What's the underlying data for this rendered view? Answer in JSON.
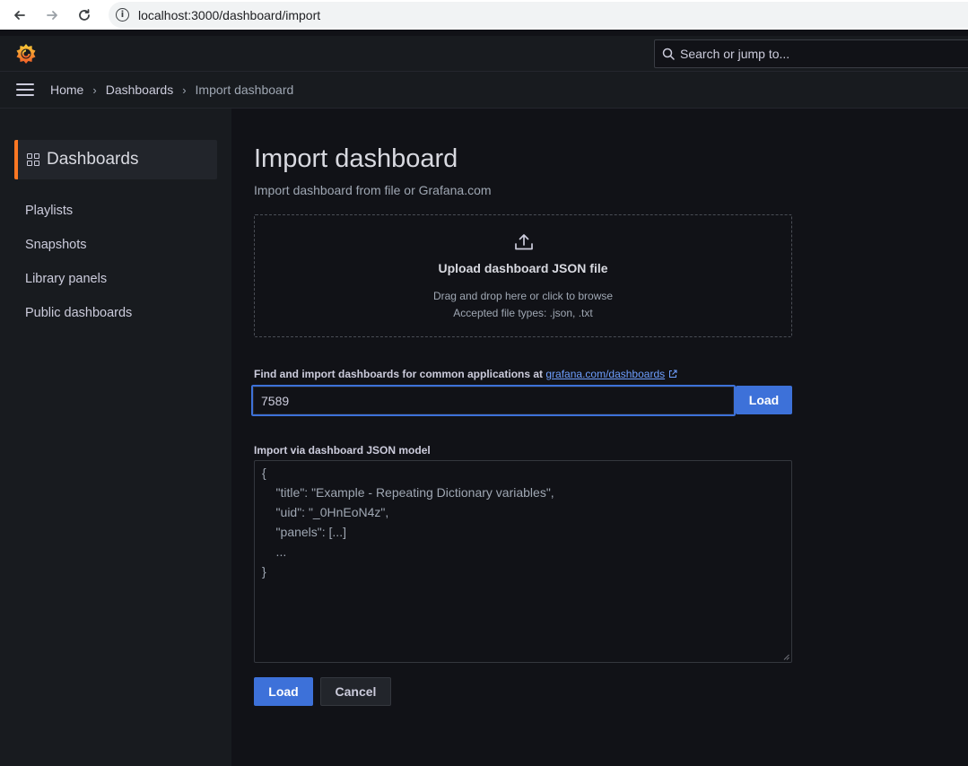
{
  "browser": {
    "url": "localhost:3000/dashboard/import",
    "back_icon": "arrow-left-icon",
    "forward_icon": "arrow-right-icon",
    "reload_icon": "reload-icon"
  },
  "topbar": {
    "search_placeholder": "Search or jump to...",
    "logo": "grafana-logo"
  },
  "breadcrumb": {
    "items": [
      "Home",
      "Dashboards",
      "Import dashboard"
    ]
  },
  "sidebar": {
    "header": "Dashboards",
    "items": [
      "Playlists",
      "Snapshots",
      "Library panels",
      "Public dashboards"
    ],
    "accent_color": "#ff7823"
  },
  "main": {
    "title": "Import dashboard",
    "subtitle": "Import dashboard from file or Grafana.com",
    "upload": {
      "title": "Upload dashboard JSON file",
      "line1": "Drag and drop here or click to browse",
      "line2": "Accepted file types: .json, .txt"
    },
    "gcom": {
      "label": "Find and import dashboards for common applications at",
      "link": "grafana.com/dashboards",
      "value": "7589",
      "load_label": "Load"
    },
    "json_model": {
      "label": "Import via dashboard JSON model",
      "lines": [
        "{",
        "    \"title\": \"Example - Repeating Dictionary variables\",",
        "    \"uid\": \"_0HnEoN4z\",",
        "    \"panels\": [...]",
        "    ...",
        "}"
      ]
    },
    "load_label": "Load",
    "cancel_label": "Cancel",
    "primary_color": "#3d71d9"
  }
}
